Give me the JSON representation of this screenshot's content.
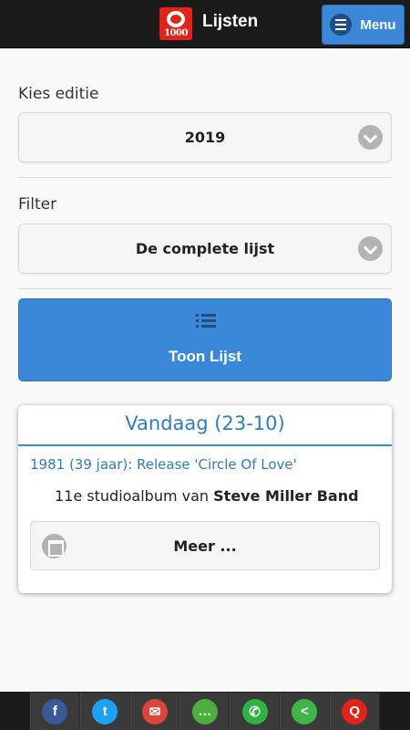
{
  "header": {
    "title": "Lijsten",
    "menu_label": "Menu",
    "logo_text": "1000"
  },
  "form": {
    "edition_label": "Kies editie",
    "edition_value": "2019",
    "filter_label": "Filter",
    "filter_value": "De complete lijst",
    "show_button": "Toon Lijst"
  },
  "today": {
    "title": "Vandaag (23-10)",
    "event": "1981 (39 jaar): Release 'Circle Of Love'",
    "desc_prefix": "11e studioalbum van ",
    "artist": "Steve Miller Band",
    "more_button": "Meer ..."
  },
  "share": {
    "buttons": [
      {
        "icon": "facebook-icon",
        "glyph": "f",
        "color": "#3b5998"
      },
      {
        "icon": "twitter-icon",
        "glyph": "t",
        "color": "#1da1f2"
      },
      {
        "icon": "email-icon",
        "glyph": "✉",
        "color": "#d9443b"
      },
      {
        "icon": "sms-icon",
        "glyph": "…",
        "color": "#4caf3d"
      },
      {
        "icon": "whatsapp-icon",
        "glyph": "✆",
        "color": "#2fb344"
      },
      {
        "icon": "share-icon",
        "glyph": "<",
        "color": "#3fb54a"
      },
      {
        "icon": "qmusic-icon",
        "glyph": "Q",
        "color": "#e2231a"
      }
    ]
  }
}
